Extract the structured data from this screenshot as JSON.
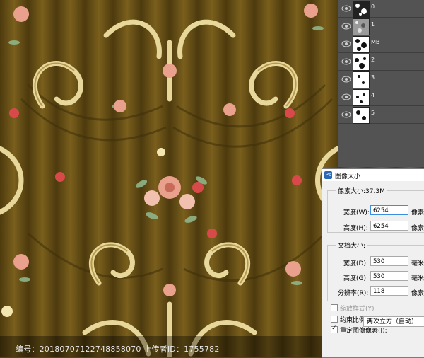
{
  "layers": [
    {
      "name": "0"
    },
    {
      "name": "1"
    },
    {
      "name": "MB"
    },
    {
      "name": "2"
    },
    {
      "name": "3"
    },
    {
      "name": "4"
    },
    {
      "name": "5"
    }
  ],
  "dialog": {
    "title": "图像大小",
    "pixel_dimensions_label": "像素大小:37.3M",
    "pixel_width_label": "宽度(W):",
    "pixel_width_value": "6254",
    "pixel_width_unit": "像素",
    "pixel_height_label": "高度(H):",
    "pixel_height_value": "6254",
    "pixel_height_unit": "像素",
    "doc_size_label": "文档大小:",
    "doc_width_label": "宽度(D):",
    "doc_width_value": "530",
    "doc_width_unit": "毫米",
    "doc_height_label": "高度(G):",
    "doc_height_value": "530",
    "doc_height_unit": "毫米",
    "resolution_label": "分辨率(R):",
    "resolution_value": "118",
    "resolution_unit": "像素",
    "scale_styles_label": "缩放样式(Y)",
    "scale_styles_checked": false,
    "constrain_label": "约束比例(C)",
    "constrain_checked": false,
    "resample_label": "重定图像像素(I):",
    "resample_checked": true,
    "resample_method": "两次立方（自动）"
  },
  "watermark": {
    "text": "编号：20180707122748858070 上传者ID：1755782"
  },
  "colors": {
    "background_brown": "#5a4512",
    "scroll_gold": "#e8d79a",
    "flower_pink": "#e9a08c",
    "leaf_green": "#8fb58a",
    "layers_panel": "#535353",
    "dialog_bg": "#f0f0f0"
  }
}
